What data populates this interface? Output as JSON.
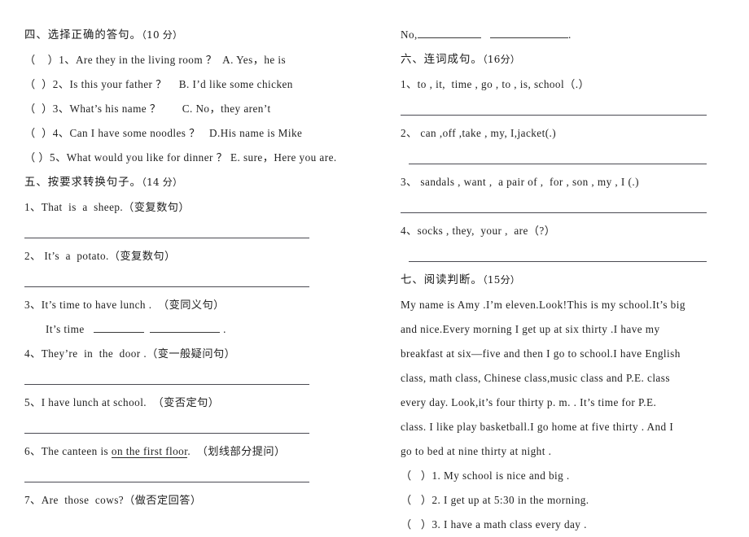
{
  "document": {
    "type": "english-exam-worksheet",
    "page_background": "#ffffff",
    "ink_color": "#222222",
    "rule_color": "#4a4a52"
  },
  "left_column": {
    "section4": {
      "heading": "四、选择正确的答句。",
      "score": "（10 分）",
      "items": [
        "（    ）1、Are they in the living room ？  A. Yes，he is",
        "（  ）2、Is this your father ？    B. I’d like some chicken",
        "（  ）3、What’s his name ？       C. No，they aren’t",
        "（  ）4、Can I have some noodles ？   D.His name is Mike",
        "（  ）5、What would you like for dinner ？ E. sure，Here you are."
      ]
    },
    "section5": {
      "heading": "五、按要求转换句子。",
      "score": "（14 分）",
      "items": [
        {
          "number": "1、",
          "text": "That  is  a  sheep.（变复数句）",
          "answer_type": "rule"
        },
        {
          "number": "2、",
          "text": " It’s  a  potato.（变复数句）",
          "answer_type": "rule"
        },
        {
          "number": "3、",
          "text": "It’s time to have lunch .  （变同义句）",
          "answer_type": "inline-blanks",
          "inline_prefix": "It’s time",
          "inline_suffix": "."
        },
        {
          "number": "4、",
          "text": "They’re  in  the  door .（变一般疑问句）",
          "answer_type": "rule"
        },
        {
          "number": "5、",
          "text": "I have lunch at school.  （变否定句）",
          "answer_type": "rule"
        },
        {
          "number": "6、",
          "text_before": "The canteen is ",
          "underlined": "on the first floor",
          "text_after": ".  （划线部分提问）",
          "answer_type": "rule"
        },
        {
          "number": "7、",
          "text": "Are  those  cows?（做否定回答）",
          "answer_type": "none"
        }
      ]
    }
  },
  "right_column": {
    "carryover_answer": {
      "prefix": "No,",
      "suffix": "."
    },
    "section6": {
      "heading": "六、连词成句。",
      "score": "（16分）",
      "items": [
        "1、to , it,  time , go , to , is, school（.）",
        "2、 can ,off ,take , my, I,jacket(.)",
        "3、 sandals , want ,  a pair of ,  for , son , my , I (.)",
        "4、socks , they,  your ,  are（?）"
      ]
    },
    "section7": {
      "heading": "七、阅读判断。",
      "score": "（15分）",
      "passage": [
        "My name is Amy .I’m eleven.Look!This is my school.It’s big",
        "and nice.Every morning I get up at six thirty .I have my",
        "breakfast at six—five and then I go to school.I have English",
        "class, math class, Chinese class,music class and P.E. class",
        "every day. Look,it’s four thirty p. m. . It’s time for P.E.",
        "class. I like play basketball.I go home at five thirty . And I",
        "go to bed at nine thirty at night ."
      ],
      "questions": [
        "（   ）1. My school is nice and big .",
        "（   ）2. I get up at 5:30 in the morning.",
        "（   ）3. I have a math class every day ."
      ]
    }
  }
}
